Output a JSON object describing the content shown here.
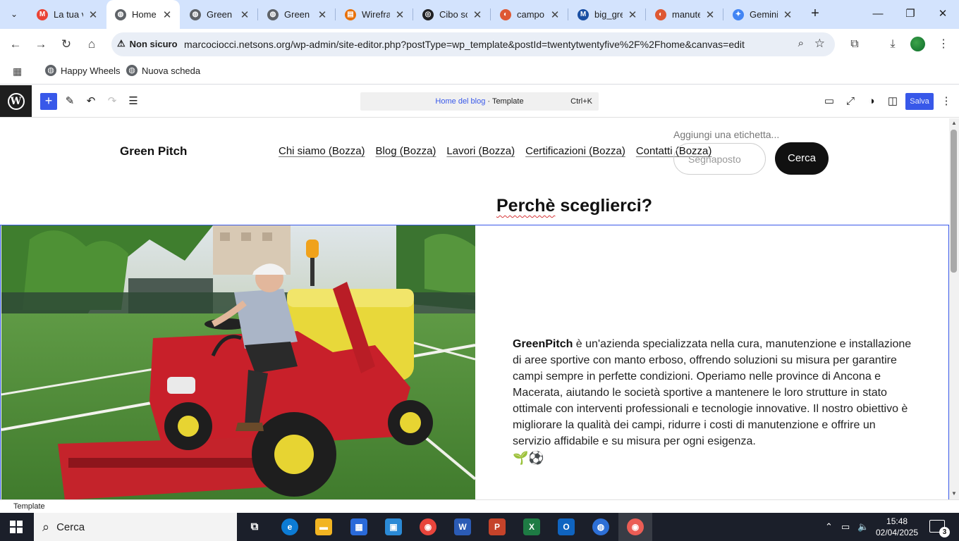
{
  "browser": {
    "tabs": [
      {
        "title": "La tua v",
        "icon": "gmail-icon",
        "color": "#ea4335",
        "glyph": "M"
      },
      {
        "title": "Home c",
        "icon": "globe-icon",
        "color": "#5f6368",
        "glyph": "◍",
        "active": true
      },
      {
        "title": "Green F",
        "icon": "globe-icon",
        "color": "#5f6368",
        "glyph": "◍"
      },
      {
        "title": "Green F",
        "icon": "globe-icon",
        "color": "#5f6368",
        "glyph": "◍"
      },
      {
        "title": "Wirefra",
        "icon": "wireframe-icon",
        "color": "#e8710a",
        "glyph": "▤"
      },
      {
        "title": "Cibo sc",
        "icon": "openai-icon",
        "color": "#202124",
        "glyph": "◎"
      },
      {
        "title": "campo",
        "icon": "duckduckgo-icon",
        "color": "#de5833",
        "glyph": "◐"
      },
      {
        "title": "big_gre",
        "icon": "m-icon",
        "color": "#1a4fa3",
        "glyph": "M"
      },
      {
        "title": "manute",
        "icon": "duckduckgo-icon",
        "color": "#de5833",
        "glyph": "◐"
      },
      {
        "title": "Gemini",
        "icon": "gemini-icon",
        "color": "#4285f4",
        "glyph": "✦"
      }
    ],
    "security_label": "Non sicuro",
    "url": "marcociocci.netsons.org/wp-admin/site-editor.php?postType=wp_template&postId=twentytwentyfive%2F%2Fhome&canvas=edit",
    "bookmarks": [
      {
        "label": "Happy Wheels"
      },
      {
        "label": "Nuova scheda"
      }
    ]
  },
  "editor": {
    "breadcrumb_link": "Home del blog",
    "breadcrumb_sep": " · ",
    "breadcrumb_type": "Template",
    "shortcut": "Ctrl+K",
    "save_label": "Salva",
    "status_label": "Template",
    "accent": "#3858e9"
  },
  "site": {
    "title": "Green Pitch",
    "nav": [
      "Chi siamo (Bozza)",
      "Blog (Bozza)",
      "Lavori (Bozza)",
      "Certificazioni (Bozza)",
      "Contatti (Bozza)"
    ],
    "search_label": "Aggiungi una etichetta...",
    "search_placeholder": "Segnaposto",
    "search_button": "Cerca",
    "heading_word": "Perchè",
    "heading_rest": " sceglierci?",
    "body_brand": "GreenPitch",
    "body_text": " è un'azienda specializzata nella cura, manutenzione e installazione di aree sportive con manto erboso, offrendo soluzioni su misura per garantire campi sempre in perfette condizioni. Operiamo nelle province di Ancona e Macerata, aiutando le società sportive a mantenere le loro strutture in stato ottimale con interventi professionali e tecnologie innovative. Il nostro obiettivo è migliorare la qualità dei campi, ridurre i costi di manutenzione e offrire un servizio affidabile e su misura per ogni esigenza.",
    "body_emoji": "🌱⚽"
  },
  "taskbar": {
    "search_label": "Cerca",
    "time": "15:48",
    "date": "02/04/2025",
    "notifications": "3"
  }
}
